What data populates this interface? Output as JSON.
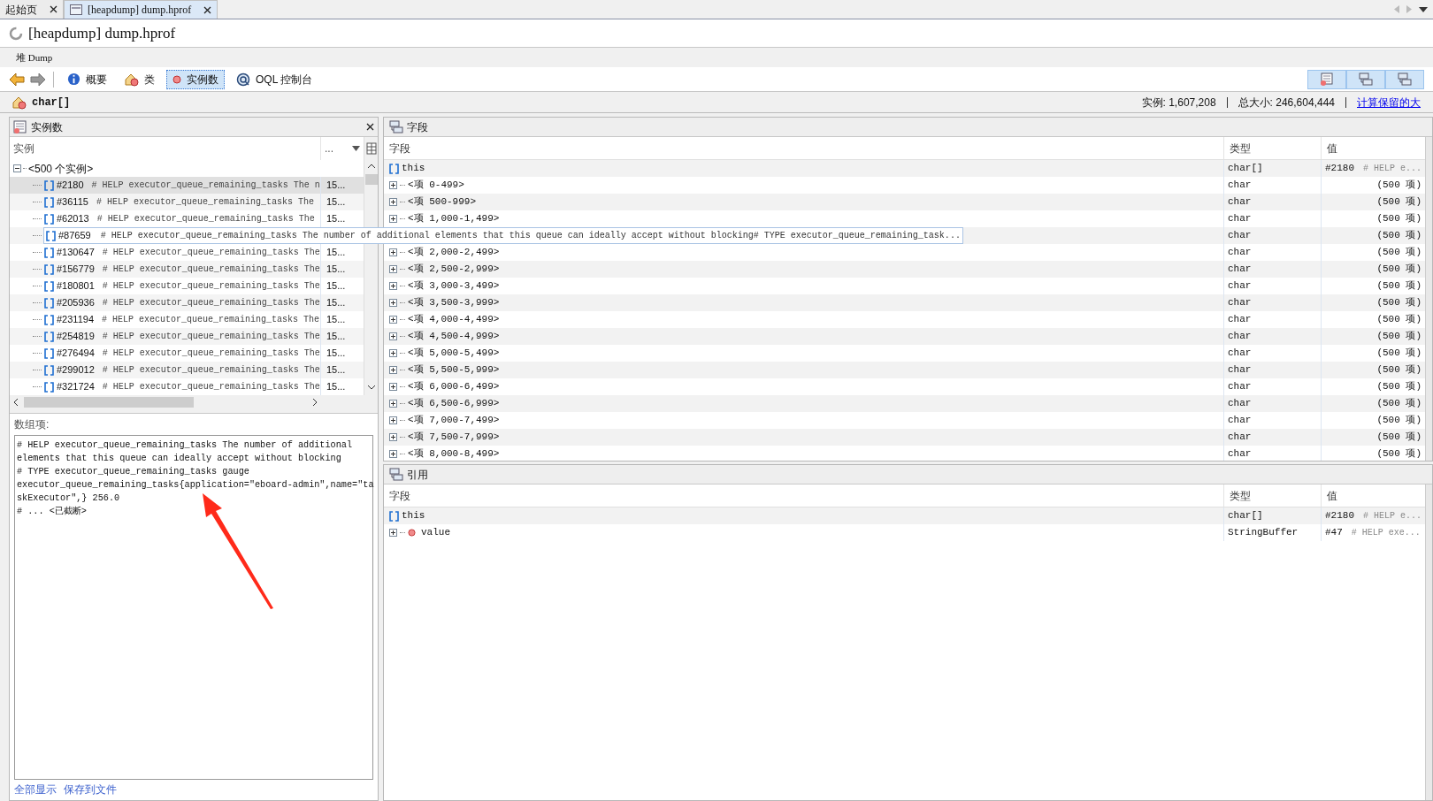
{
  "tabs": [
    {
      "label": "起始页",
      "selected": false
    },
    {
      "label": "[heapdump] dump.hprof",
      "selected": true
    }
  ],
  "title": "[heapdump] dump.hprof",
  "breadcrumb": "堆 Dump",
  "toolbar": [
    {
      "label": "概要",
      "kind": "info",
      "selected": false
    },
    {
      "label": "类",
      "kind": "class",
      "selected": false
    },
    {
      "label": "实例数",
      "kind": "instance",
      "selected": true
    },
    {
      "label": "OQL 控制台",
      "kind": "oql",
      "selected": false
    }
  ],
  "class_bar": {
    "name": "char[]",
    "instances": "实例: 1,607,208",
    "total_size": "总大小: 246,604,444",
    "link": "计算保留的大"
  },
  "instances_panel": {
    "title": "实例数",
    "columns": [
      "实例",
      "..."
    ],
    "group": "<500 个实例>",
    "rows": [
      {
        "id": "#2180",
        "value": "# HELP executor_queue_remaining_tasks The n",
        "size": "15...",
        "selected": true,
        "tooltip": false
      },
      {
        "id": "#36115",
        "value": "# HELP executor_queue_remaining_tasks The",
        "size": "15...",
        "selected": false,
        "tooltip": false
      },
      {
        "id": "#62013",
        "value": "# HELP executor_queue_remaining_tasks The",
        "size": "15...",
        "selected": false,
        "tooltip": false
      },
      {
        "id": "#87659",
        "value": "# HELP executor_queue_remaining_tasks The number of additional elements that this queue can ideally accept without blocking# TYPE executor_queue_remaining_task...",
        "selected": false,
        "tooltip": true
      },
      {
        "id": "#130647",
        "value": "# HELP executor_queue_remaining_tasks The",
        "size": "15...",
        "selected": false,
        "tooltip": false
      },
      {
        "id": "#156779",
        "value": "# HELP executor_queue_remaining_tasks The",
        "size": "15...",
        "selected": false,
        "tooltip": false
      },
      {
        "id": "#180801",
        "value": "# HELP executor_queue_remaining_tasks The",
        "size": "15...",
        "selected": false,
        "tooltip": false
      },
      {
        "id": "#205936",
        "value": "# HELP executor_queue_remaining_tasks The",
        "size": "15...",
        "selected": false,
        "tooltip": false
      },
      {
        "id": "#231194",
        "value": "# HELP executor_queue_remaining_tasks The",
        "size": "15...",
        "selected": false,
        "tooltip": false
      },
      {
        "id": "#254819",
        "value": "# HELP executor_queue_remaining_tasks The",
        "size": "15...",
        "selected": false,
        "tooltip": false
      },
      {
        "id": "#276494",
        "value": "# HELP executor_queue_remaining_tasks The",
        "size": "15...",
        "selected": false,
        "tooltip": false
      },
      {
        "id": "#299012",
        "value": "# HELP executor_queue_remaining_tasks The",
        "size": "15...",
        "selected": false,
        "tooltip": false
      },
      {
        "id": "#321724",
        "value": "# HELP executor_queue_remaining_tasks The",
        "size": "15...",
        "selected": false,
        "tooltip": false
      }
    ]
  },
  "array_items": {
    "label": "数组项:",
    "lines": [
      "# HELP executor_queue_remaining_tasks The number of additional",
      "elements that this queue can ideally accept without blocking",
      "# TYPE executor_queue_remaining_tasks gauge",
      "executor_queue_remaining_tasks{application=\"eboard-admin\",name=\"ta",
      "skExecutor\",} 256.0",
      "# ... <已截断>"
    ],
    "links": [
      "全部显示",
      "保存到文件"
    ]
  },
  "fields_panel": {
    "title": "字段",
    "columns": [
      "字段",
      "类型",
      "值"
    ],
    "rows": [
      {
        "kind": "this",
        "name": "this",
        "type": "char[]",
        "value": "#2180",
        "preview": "# HELP e..."
      },
      {
        "kind": "range",
        "name": "<项 0-499>",
        "type": "char",
        "value": "(500 项)"
      },
      {
        "kind": "range",
        "name": "<项 500-999>",
        "type": "char",
        "value": "(500 项)"
      },
      {
        "kind": "range",
        "name": "<项 1,000-1,499>",
        "type": "char",
        "value": "(500 项)"
      },
      {
        "kind": "hidden",
        "type": "char",
        "value": "(500 项)"
      },
      {
        "kind": "range",
        "name": "<项 2,000-2,499>",
        "type": "char",
        "value": "(500 项)"
      },
      {
        "kind": "range",
        "name": "<项 2,500-2,999>",
        "type": "char",
        "value": "(500 项)"
      },
      {
        "kind": "range",
        "name": "<项 3,000-3,499>",
        "type": "char",
        "value": "(500 项)"
      },
      {
        "kind": "range",
        "name": "<项 3,500-3,999>",
        "type": "char",
        "value": "(500 项)"
      },
      {
        "kind": "range",
        "name": "<项 4,000-4,499>",
        "type": "char",
        "value": "(500 项)"
      },
      {
        "kind": "range",
        "name": "<项 4,500-4,999>",
        "type": "char",
        "value": "(500 项)"
      },
      {
        "kind": "range",
        "name": "<项 5,000-5,499>",
        "type": "char",
        "value": "(500 项)"
      },
      {
        "kind": "range",
        "name": "<项 5,500-5,999>",
        "type": "char",
        "value": "(500 项)"
      },
      {
        "kind": "range",
        "name": "<项 6,000-6,499>",
        "type": "char",
        "value": "(500 项)"
      },
      {
        "kind": "range",
        "name": "<项 6,500-6,999>",
        "type": "char",
        "value": "(500 项)"
      },
      {
        "kind": "range",
        "name": "<项 7,000-7,499>",
        "type": "char",
        "value": "(500 项)"
      },
      {
        "kind": "range",
        "name": "<项 7,500-7,999>",
        "type": "char",
        "value": "(500 项)"
      },
      {
        "kind": "range",
        "name": "<项 8,000-8,499>",
        "type": "char",
        "value": "(500 项)"
      }
    ]
  },
  "references_panel": {
    "title": "引用",
    "columns": [
      "字段",
      "类型",
      "值"
    ],
    "rows": [
      {
        "kind": "this",
        "name": "this",
        "type": "char[]",
        "value": "#2180",
        "preview": "# HELP e..."
      },
      {
        "kind": "object",
        "name": "value",
        "type": "StringBuffer",
        "value": "#47",
        "preview": "# HELP exe..."
      }
    ]
  }
}
